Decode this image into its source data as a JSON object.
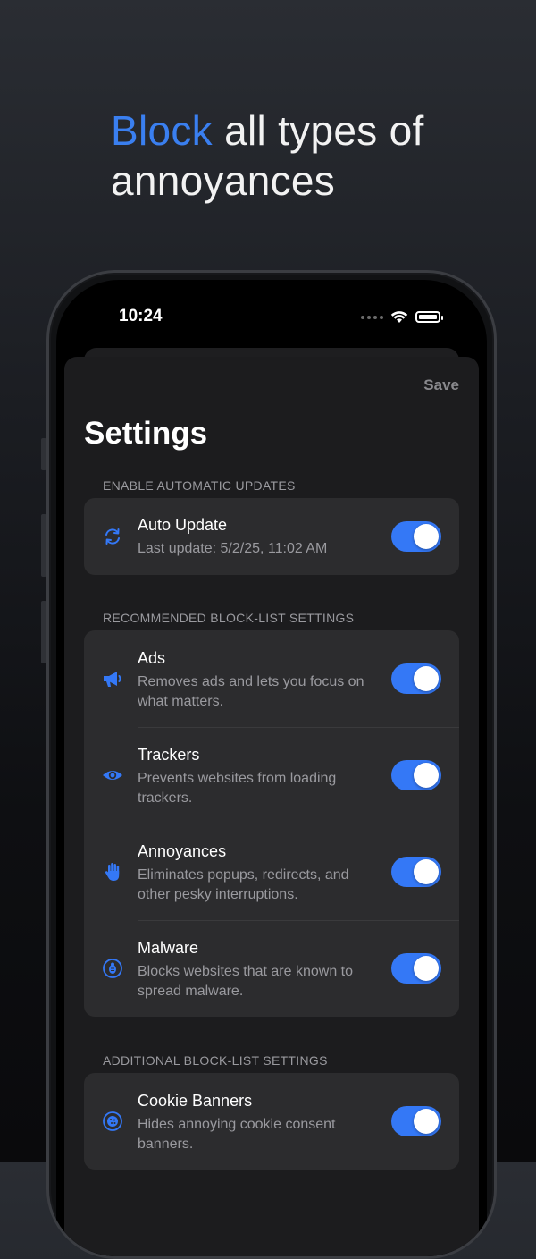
{
  "headline": {
    "accent": "Block",
    "rest": " all types of annoyances"
  },
  "status_bar": {
    "time": "10:24"
  },
  "sheet": {
    "save_label": "Save",
    "title": "Settings",
    "sections": [
      {
        "label": "ENABLE AUTOMATIC UPDATES",
        "items": [
          {
            "title": "Auto Update",
            "description": "Last update: 5/2/25, 11:02 AM",
            "icon": "refresh-icon",
            "enabled": true
          }
        ]
      },
      {
        "label": "RECOMMENDED BLOCK-LIST SETTINGS",
        "items": [
          {
            "title": "Ads",
            "description": "Removes ads and lets you focus on what matters.",
            "icon": "megaphone-icon",
            "enabled": true
          },
          {
            "title": "Trackers",
            "description": "Prevents websites from loading trackers.",
            "icon": "eye-icon",
            "enabled": true
          },
          {
            "title": "Annoyances",
            "description": "Eliminates popups, redirects, and other pesky interruptions.",
            "icon": "hand-icon",
            "enabled": true
          },
          {
            "title": "Malware",
            "description": "Blocks websites that are known to spread malware.",
            "icon": "bug-icon",
            "enabled": true
          }
        ]
      },
      {
        "label": "ADDITIONAL BLOCK-LIST SETTINGS",
        "items": [
          {
            "title": "Cookie Banners",
            "description": "Hides annoying cookie consent banners.",
            "icon": "cookie-icon",
            "enabled": true
          }
        ]
      }
    ]
  },
  "colors": {
    "accent": "#3478f6",
    "headline_accent": "#3a7ff0",
    "card": "#2c2c2e",
    "sheet": "#1c1c1e"
  }
}
